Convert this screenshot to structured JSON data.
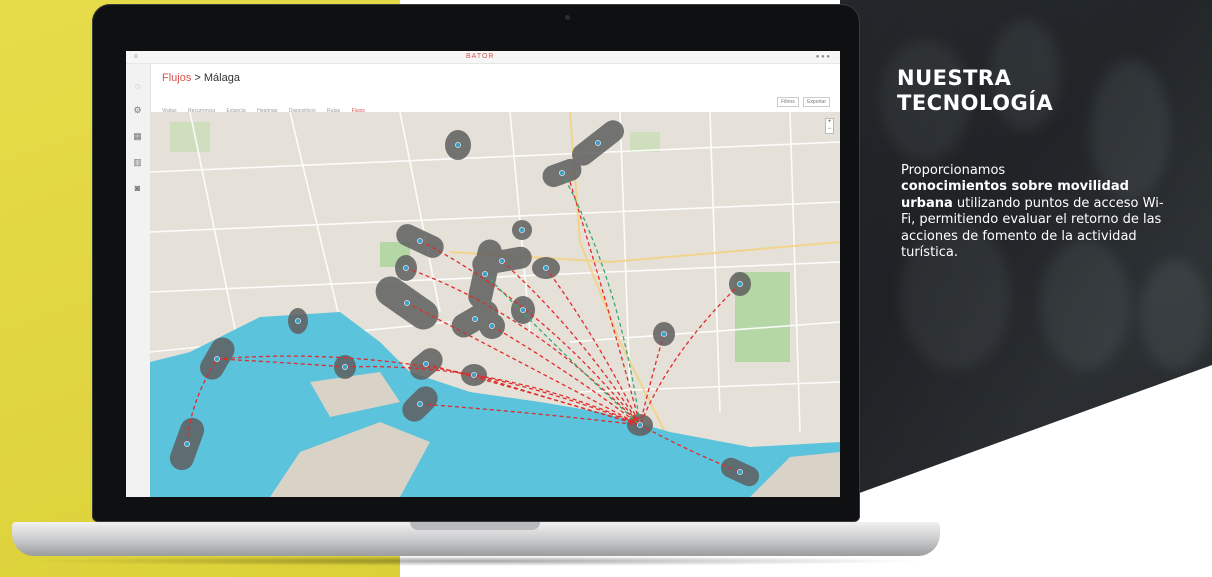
{
  "right_panel": {
    "heading_line1": "NUESTRA",
    "heading_line2": "TECNOLOGÍA",
    "body_intro": "Proporcionamos",
    "body_bold": "conocimientos sobre movilidad urbana",
    "body_rest": "utilizando puntos de acceso Wi-Fi, permitiendo evaluar el retorno de las acciones de fomento de la actividad turística."
  },
  "app": {
    "brand": "BATOR",
    "breadcrumb_root": "Flujos",
    "breadcrumb_sep": " > ",
    "breadcrumb_current": "Málaga",
    "subtitle": "",
    "tabs": [
      {
        "label": "Visitas",
        "active": false
      },
      {
        "label": "Recurrencia",
        "active": false
      },
      {
        "label": "Estancia",
        "active": false
      },
      {
        "label": "Heatmap",
        "active": false
      },
      {
        "label": "Dispositivos",
        "active": false
      },
      {
        "label": "Rutas",
        "active": false
      },
      {
        "label": "Flujos",
        "active": true
      }
    ],
    "toolbar": {
      "filter": "Filtros",
      "export": "Exportar"
    }
  },
  "colors": {
    "yellow": "#e4d93a",
    "route_red": "#e02b2b",
    "route_green": "#3aa86b",
    "zone_gray": "#5f5f5f",
    "sea": "#5bc3dc",
    "land": "#e5e1d8",
    "park": "#a9d59a"
  },
  "icons": [
    "camera-icon",
    "settings-icon",
    "grid-icon",
    "chart-icon",
    "pin-icon"
  ]
}
